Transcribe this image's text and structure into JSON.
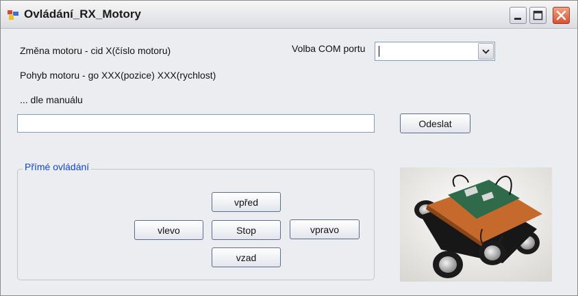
{
  "window": {
    "title": "Ovládání_RX_Motory",
    "controls": {
      "minimize": "minimize-icon",
      "maximize": "maximize-icon",
      "close": "close-icon"
    }
  },
  "labels": {
    "change_motor": "Změna motoru - cid X(číslo motoru)",
    "move_motor": "Pohyb motoru - go XXX(pozice) XXX(rychlost)",
    "manual": "... dle manuálu",
    "com_port": "Volba COM portu"
  },
  "com_port_select": {
    "value": ""
  },
  "command_input": {
    "value": ""
  },
  "send_button": {
    "label": "Odeslat"
  },
  "direct_control": {
    "title": "Přímé ovládání",
    "forward": "vpřed",
    "left": "vlevo",
    "stop": "Stop",
    "right": "vpravo",
    "back": "vzad"
  },
  "colors": {
    "group_title": "#0b46c8",
    "close_button": "#d9512d",
    "window_bg": "#ecedf0"
  },
  "image": {
    "subject": "robot-vehicle-photo"
  }
}
